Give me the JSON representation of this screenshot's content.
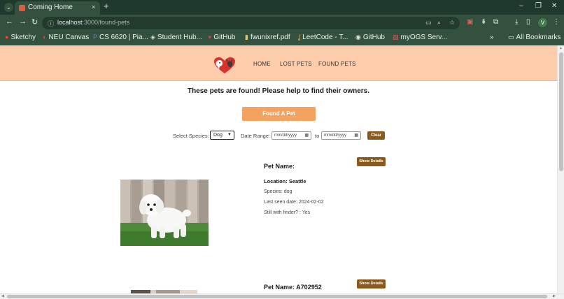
{
  "browser": {
    "tab_title": "Coming Home",
    "tab_close": "×",
    "new_tab": "+",
    "url_host": "localhost",
    "url_path": ":3000/found-pets",
    "window_minimize": "–",
    "window_restore": "❐",
    "window_close": "✕",
    "back": "←",
    "forward": "→",
    "reload": "↻",
    "profile_initial": "V"
  },
  "bookmarks": [
    {
      "label": "Sketchy",
      "icon": "●",
      "color": "#e04a3a"
    },
    {
      "label": "NEU Canvas",
      "icon": "◐",
      "color": "#d9453a"
    },
    {
      "label": "CS 6620 | Pia...",
      "icon": "P",
      "color": "#5b7fd6"
    },
    {
      "label": "Student Hub...",
      "icon": "◈",
      "color": "#dddddd"
    },
    {
      "label": "GitHub",
      "icon": "♥",
      "color": "#c84343"
    },
    {
      "label": "fwunixref.pdf",
      "icon": "▮",
      "color": "#e8c25b"
    },
    {
      "label": "LeetCode - T...",
      "icon": "ʆ",
      "color": "#f0a63a"
    },
    {
      "label": "GitHub",
      "icon": "◉",
      "color": "#e6e6e6"
    },
    {
      "label": "myOGS Serv...",
      "icon": "▧",
      "color": "#e05060"
    }
  ],
  "bookmarks_more": "»",
  "all_bookmarks": "All Bookmarks",
  "nav": {
    "home": "HOME",
    "lost": "LOST PETS",
    "found": "FOUND PETS"
  },
  "headline": "These pets are found! Please help to find their owners.",
  "found_button": "Found A Pet",
  "filters": {
    "species_label": "Select Species:",
    "species_value": "Dog",
    "date_label": "Date Range:",
    "date_from": "mm/dd/yyyy",
    "date_to_label": "to",
    "date_to": "mm/dd/yyyy",
    "clear": "Clear"
  },
  "pets": [
    {
      "name": "Pet Name:",
      "location": "Location: Seattle",
      "species": "Species: dog",
      "last_seen": "Last seen date: 2024-02-02",
      "with_finder": "Still with finder? : Yes",
      "details": "Show Details"
    },
    {
      "name": "Pet Name: A702952",
      "details": "Show Details"
    }
  ],
  "colors": {
    "header_bg": "#fdccaa",
    "found_button": "#f3a35f",
    "details_button": "#8a5a1c",
    "chrome_bg": "#34503e"
  }
}
